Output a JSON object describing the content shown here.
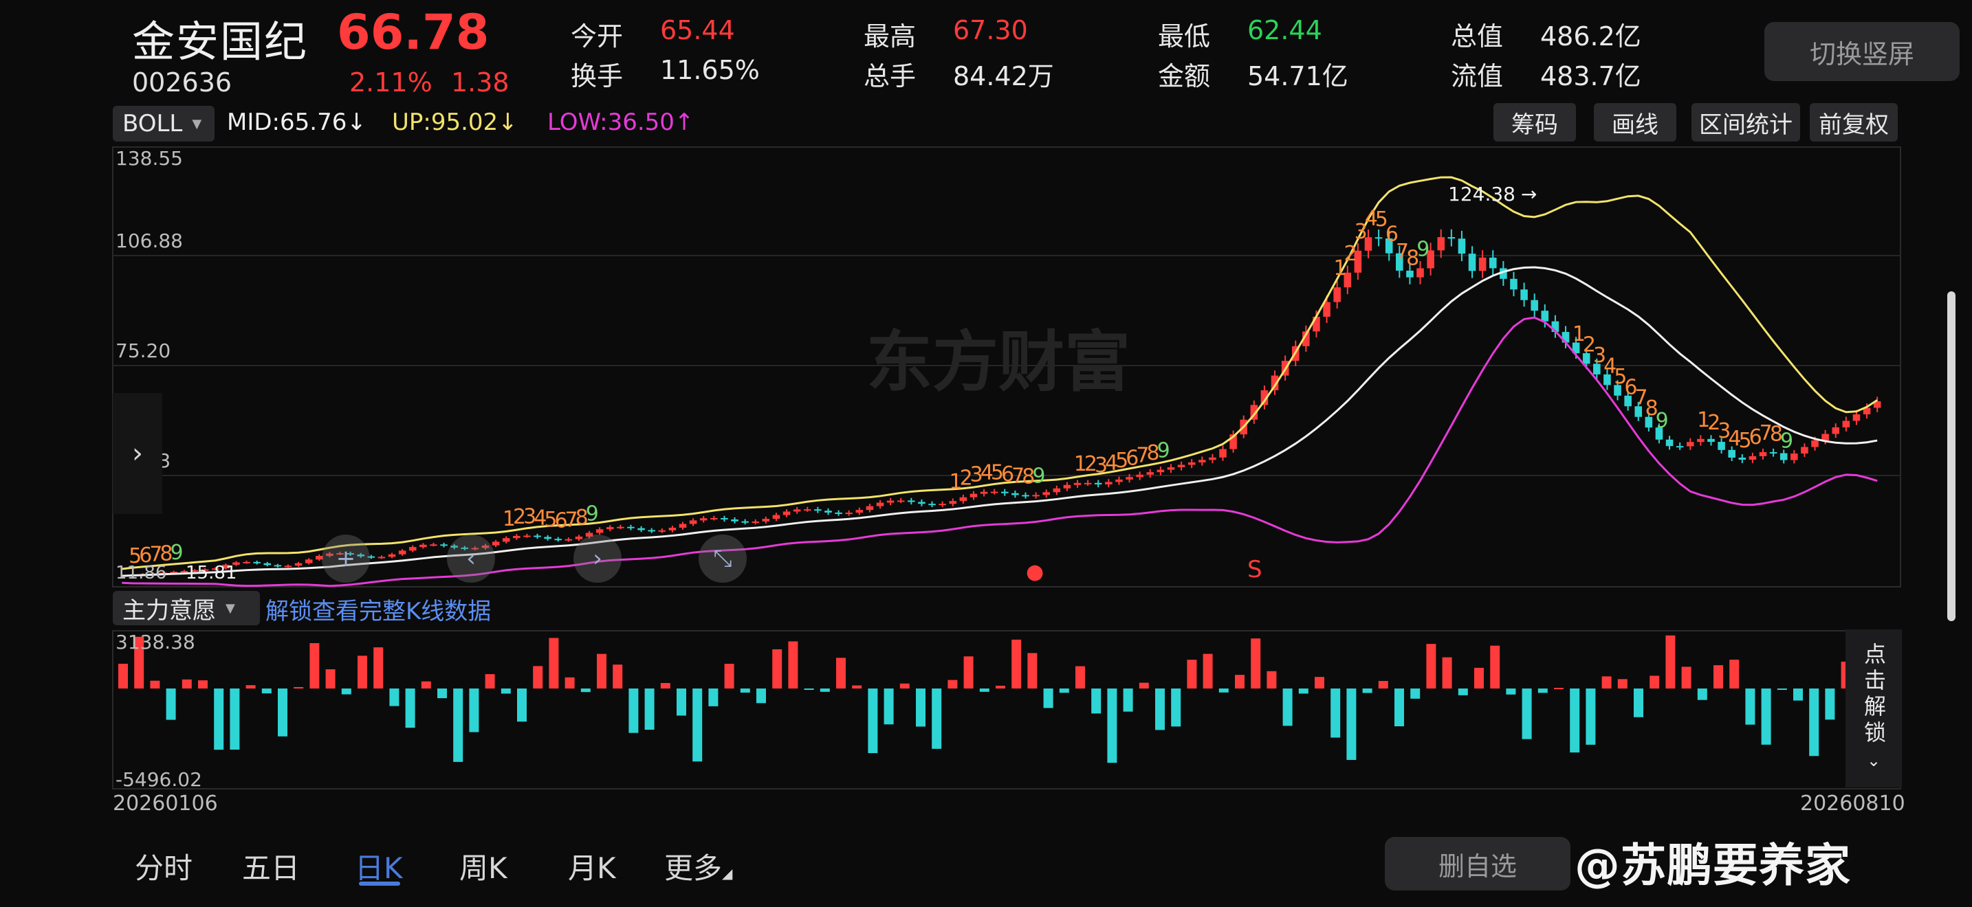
{
  "stock": {
    "name": "金安国纪",
    "price": "66.78",
    "code": "002636",
    "change_pct": "2.11%",
    "change": "1.38"
  },
  "quote": [
    {
      "label": "今开",
      "value": "65.44",
      "color": "red"
    },
    {
      "label": "最高",
      "value": "67.30",
      "color": "red"
    },
    {
      "label": "最低",
      "value": "62.44",
      "color": "green"
    },
    {
      "label": "总值",
      "value": "486.2亿",
      "color": "white"
    },
    {
      "label": "换手",
      "value": "11.65%",
      "color": "white"
    },
    {
      "label": "总手",
      "value": "84.42万",
      "color": "white"
    },
    {
      "label": "金额",
      "value": "54.71亿",
      "color": "white"
    },
    {
      "label": "流值",
      "value": "483.7亿",
      "color": "white"
    }
  ],
  "switch_label": "切换竖屏",
  "indicator": {
    "name": "BOLL",
    "mid": "MID:65.76",
    "up": "UP:95.02",
    "low": "LOW:36.50",
    "mid_arrow": "↓",
    "up_arrow": "↓",
    "low_arrow": "↑"
  },
  "tools": [
    "筹码",
    "画线",
    "区间统计",
    "前复权"
  ],
  "colors": {
    "mid": "#f0f0f0",
    "up": "#f2e36b",
    "low": "#e63ad8",
    "up_candle": "#ff3b3b",
    "down_candle": "#2fd4d4",
    "accent": "#4a7bdc"
  },
  "y_axis": [
    "138.55",
    "106.88",
    "75.20",
    "43.53",
    "11.86"
  ],
  "annotations": {
    "high": "124.38",
    "low": "15.81",
    "low_prefix": "11.86"
  },
  "signals": {
    "buy": "●",
    "sell": "S"
  },
  "watermark_center": "东方财富",
  "moneyflow": {
    "name": "主力意愿",
    "unlock_text": "解锁查看完整K线数据",
    "max": "3138.38",
    "min": "-5496.02",
    "side_button": "点击解锁"
  },
  "dates": {
    "start": "20260106",
    "end": "20260810"
  },
  "period_tabs": [
    {
      "label": "分时",
      "active": false
    },
    {
      "label": "五日",
      "active": false
    },
    {
      "label": "日K",
      "active": true
    },
    {
      "label": "周K",
      "active": false
    },
    {
      "label": "月K",
      "active": false
    },
    {
      "label": "更多",
      "active": false
    }
  ],
  "delete_label": "删自选",
  "weibo_watermark": "@苏鹏要养家"
}
